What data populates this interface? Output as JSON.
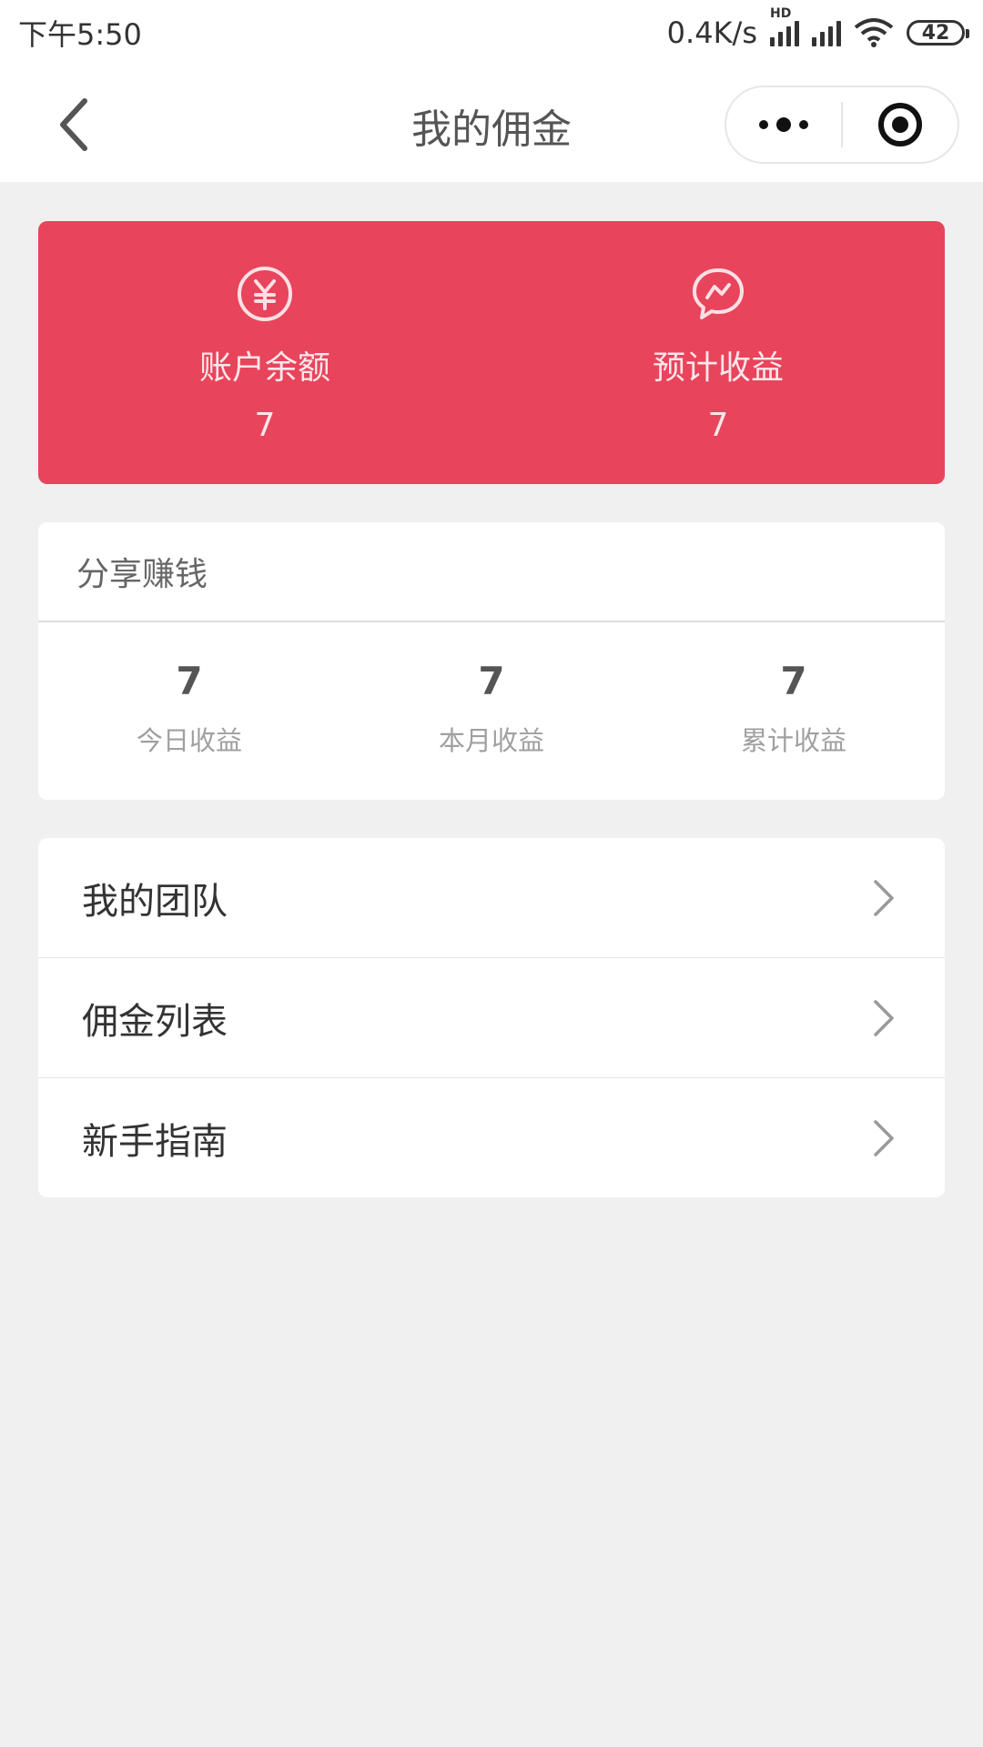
{
  "status_bar": {
    "time": "下午5:50",
    "network_speed": "0.4K/s",
    "network_type": "HD",
    "battery": "42"
  },
  "nav": {
    "title": "我的佣金",
    "icons": {
      "back": "chevron-left-icon",
      "more": "more-dots-icon",
      "close": "target-close-icon"
    }
  },
  "balance_card": {
    "bg_color": "#e8445c",
    "account_balance": {
      "label": "账户余额",
      "value": "7",
      "icon": "yuan-icon"
    },
    "estimated_income": {
      "label": "预计收益",
      "value": "7",
      "icon": "chat-trend-icon"
    }
  },
  "share": {
    "title": "分享赚钱",
    "stats": [
      {
        "value": "7",
        "label": "今日收益"
      },
      {
        "value": "7",
        "label": "本月收益"
      },
      {
        "value": "7",
        "label": "累计收益"
      }
    ]
  },
  "menu": {
    "items": [
      {
        "label": "我的团队"
      },
      {
        "label": "佣金列表"
      },
      {
        "label": "新手指南"
      }
    ]
  }
}
